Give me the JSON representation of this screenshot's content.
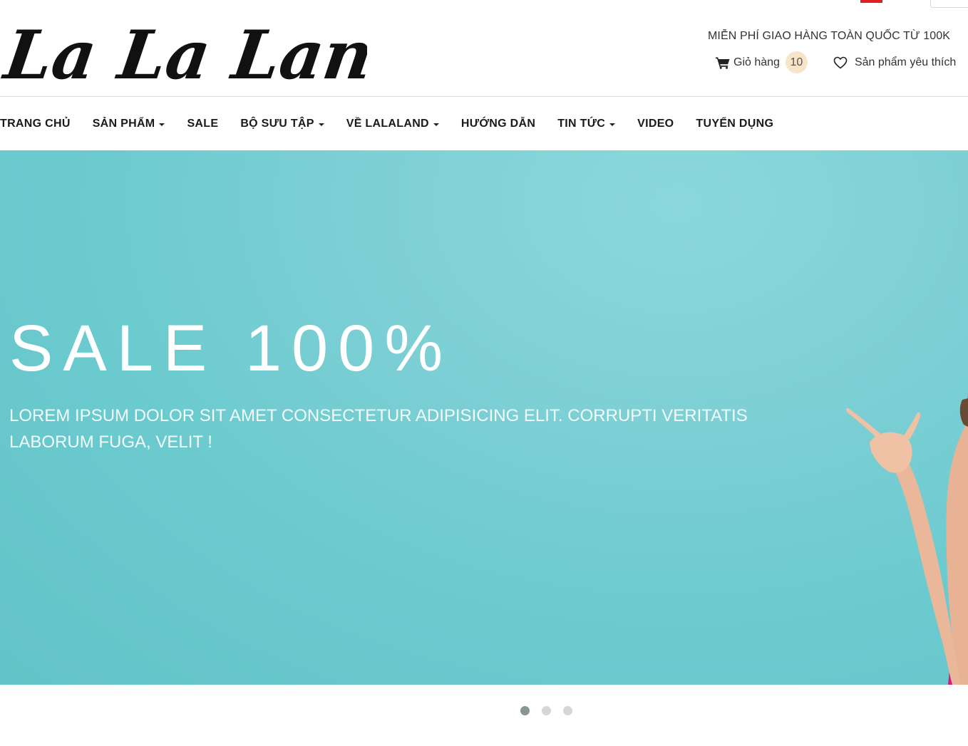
{
  "header": {
    "logo_text": "La La Land",
    "free_shipping": "MIỄN PHÍ GIAO HÀNG TOÀN QUỐC TỪ 100K",
    "cart_label": "Giỏ hàng",
    "cart_count": "10",
    "wishlist_label": "Sản phẩm yêu thích"
  },
  "nav": {
    "items": [
      {
        "label": "TRANG CHỦ"
      },
      {
        "label": "SẢN PHẨM"
      },
      {
        "label": "SALE"
      },
      {
        "label": "BỘ SƯU TẬP"
      },
      {
        "label": "VỀ LALALAND"
      },
      {
        "label": "HƯỚNG DẪN"
      },
      {
        "label": "TIN TỨC"
      },
      {
        "label": "VIDEO"
      },
      {
        "label": "TUYỂN DỤNG"
      }
    ]
  },
  "hero": {
    "title": "SALE 100%",
    "subtitle": "LOREM IPSUM DOLOR SIT AMET CONSECTETUR ADIPISICING ELIT. CORRUPTI VERITATIS LABORUM FUGA, VELIT !"
  },
  "carousel": {
    "slide_count": 3,
    "active_index": 0
  },
  "colors": {
    "hero_bg": "#6ccbcf",
    "badge_bg": "#f8e4c6",
    "active_dot": "#869791",
    "inactive_dot": "#d6d6d6",
    "top_accent": "#e02020"
  }
}
